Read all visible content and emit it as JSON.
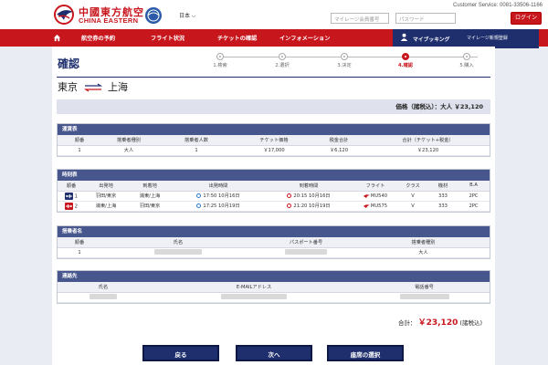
{
  "header": {
    "logo_cn": "中國東方航空",
    "logo_en": "CHINA EASTERN",
    "language": "日本 ⌵",
    "customer_service": "Customer Service: 0081-33506-1166",
    "mileage_placeholder": "マイレージ会員番号",
    "password_placeholder": "パスワード",
    "login_label": "ログイン"
  },
  "nav": {
    "items": [
      "航空券の予約",
      "フライト状況",
      "チケットの確認",
      "インフォメーション"
    ],
    "my_booking": "マイブッキング",
    "mileage_register": "マイレージ新規登録"
  },
  "page": {
    "title": "確認",
    "steps": [
      "1.検索",
      "2.選択",
      "3.決定",
      "4.確認",
      "5.購入"
    ],
    "active_step": 3,
    "route_from": "東京",
    "route_to": "上海",
    "price_summary": "価格（諸税込）：大人 ￥23,120"
  },
  "fare": {
    "title": "運賃表",
    "headers": [
      "順番",
      "搭乗者種別",
      "搭乗者人数",
      "チケット価格",
      "税金合計",
      "合計（チケット+税金）"
    ],
    "rows": [
      [
        "1",
        "大人",
        "1",
        "￥17,000",
        "￥6,120",
        "￥23,120"
      ]
    ]
  },
  "schedule": {
    "title": "時刻表",
    "headers": [
      "順番",
      "出発地",
      "到着地",
      "出発時間",
      "到着時間",
      "フライト",
      "クラス",
      "機材",
      "B.A"
    ],
    "rows": [
      {
        "no": "1",
        "from": "羽田/東京",
        "to": "浦東/上海",
        "dep": "17:50 10月16日",
        "arr": "20:15 10月16日",
        "flight": "MU540",
        "class": "V",
        "aircraft": "333",
        "ba": "2PC"
      },
      {
        "no": "2",
        "from": "浦東/上海",
        "to": "羽田/東京",
        "dep": "17:25 10月19日",
        "arr": "21:20 10月19日",
        "flight": "MU575",
        "class": "V",
        "aircraft": "333",
        "ba": "2PC"
      }
    ]
  },
  "passenger": {
    "title": "搭乗者名",
    "headers": [
      "順番",
      "氏名",
      "パスポート番号",
      "搭乗者種別"
    ],
    "rows": [
      [
        "1",
        "",
        "",
        "大人"
      ]
    ]
  },
  "contact": {
    "title": "連絡先",
    "headers": [
      "氏名",
      "E-MAILアドレス",
      "電話番号"
    ]
  },
  "total": {
    "label": "合計：",
    "amount": "￥23,120",
    "suffix": "(諸税込)"
  },
  "buttons": {
    "back": "戻る",
    "next": "次へ",
    "seat": "座席の選択"
  },
  "colors": {
    "brand_red": "#c8161d",
    "navy": "#1f2f6d",
    "section_header": "#47568d"
  }
}
